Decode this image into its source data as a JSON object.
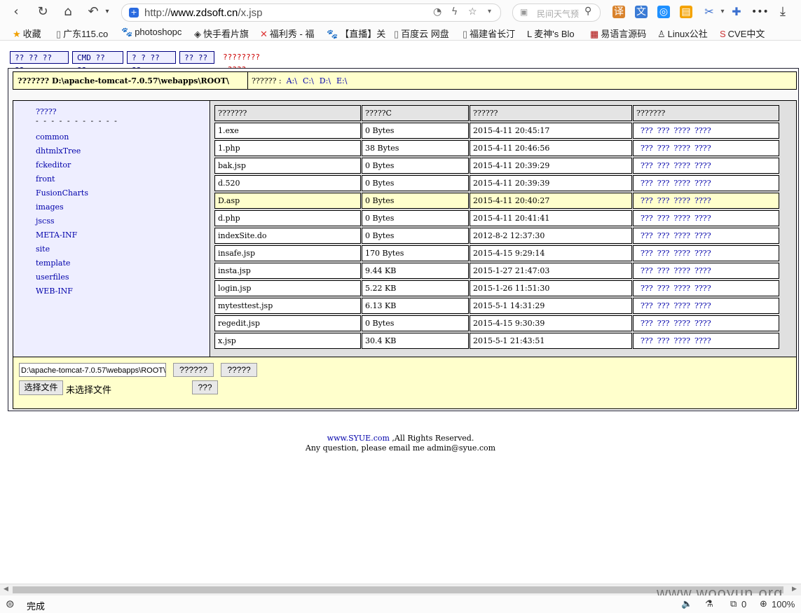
{
  "browser": {
    "url_prefix": "http://",
    "url_host": "www.zdsoft.cn",
    "url_path": "/x.jsp",
    "search_placeholder": "民间天气预",
    "nav": {
      "back": "‹",
      "refresh": "↻",
      "home": "⌂",
      "undo": "↶"
    },
    "menu_icon": "•••",
    "download_icon": "⤓"
  },
  "bookmarks": [
    {
      "label": "收藏",
      "icon": "★"
    },
    {
      "label": "广东115.co",
      "icon": "▯"
    },
    {
      "label": "photoshopc",
      "icon": "🐾"
    },
    {
      "label": "快手看片旗",
      "icon": "◈"
    },
    {
      "label": "福利秀 - 福",
      "icon": "✕"
    },
    {
      "label": "【直播】关",
      "icon": "🐾"
    },
    {
      "label": "百度云 网盘",
      "icon": "▯"
    },
    {
      "label": "福建省长汀",
      "icon": "▯"
    },
    {
      "label": "麦神's Blo",
      "icon": "L"
    },
    {
      "label": "易语言源码",
      "icon": "▦"
    },
    {
      "label": "Linux公社",
      "icon": "♙"
    },
    {
      "label": "CVE中文",
      "icon": "S"
    }
  ],
  "page": {
    "tabs": [
      "?? ?? ?? ??",
      "CMD ?? ??",
      "? ? ?? ??",
      "?? ??"
    ],
    "tab_note": "????????-????",
    "current_path_label": "???????",
    "current_path": "D:\\apache-tomcat-7.0.57\\webapps\\ROOT\\",
    "drives_label": "?????? :",
    "drives": [
      "A:\\",
      "C:\\",
      "D:\\",
      "E:\\"
    ],
    "dir_panel_title": "?????",
    "dir_panel_dash": "- - - - - - - - - - -",
    "directories": [
      "common",
      "dhtmlxTree",
      "fckeditor",
      "front",
      "FusionCharts",
      "images",
      "jscss",
      "META-INF",
      "site",
      "template",
      "userfiles",
      "WEB-INF"
    ],
    "file_headers": [
      "???????",
      "?????C",
      "??????",
      "???????"
    ],
    "files": [
      {
        "name": "1.exe",
        "size": "0 Bytes",
        "date": "2015-4-11 20:45:17"
      },
      {
        "name": "1.php",
        "size": "38 Bytes",
        "date": "2015-4-11 20:46:56"
      },
      {
        "name": "bak.jsp",
        "size": "0 Bytes",
        "date": "2015-4-11 20:39:29"
      },
      {
        "name": "d.520",
        "size": "0 Bytes",
        "date": "2015-4-11 20:39:39"
      },
      {
        "name": "D.asp",
        "size": "0 Bytes",
        "date": "2015-4-11 20:40:27"
      },
      {
        "name": "d.php",
        "size": "0 Bytes",
        "date": "2015-4-11 20:41:41"
      },
      {
        "name": "indexSite.do",
        "size": "0 Bytes",
        "date": "2012-8-2 12:37:30"
      },
      {
        "name": "insafe.jsp",
        "size": "170 Bytes",
        "date": "2015-4-15 9:29:14"
      },
      {
        "name": "insta.jsp",
        "size": "9.44 KB",
        "date": "2015-1-27 21:47:03"
      },
      {
        "name": "login.jsp",
        "size": "5.22 KB",
        "date": "2015-1-26 11:51:30"
      },
      {
        "name": "mytesttest.jsp",
        "size": "6.13 KB",
        "date": "2015-5-1 14:31:29"
      },
      {
        "name": "regedit.jsp",
        "size": "0 Bytes",
        "date": "2015-4-15 9:30:39"
      },
      {
        "name": "x.jsp",
        "size": "30.4 KB",
        "date": "2015-5-1 21:43:51"
      }
    ],
    "highlight_row": 4,
    "actions": [
      "???",
      "???",
      "????",
      "????"
    ],
    "path_input_value": "D:\\apache-tomcat-7.0.57\\webapps\\ROOT\\",
    "btn_create_file": "??????",
    "btn_create_dir": "?????",
    "choose_file": "选择文件",
    "no_file": "未选择文件",
    "btn_upload": "???",
    "footer_link": "www.SYUE.com",
    "footer_line1_rest": " ,All Rights Reserved.",
    "footer_line2": "Any question, please email me admin@syue.com"
  },
  "status": {
    "text": "完成",
    "zoom": "100%",
    "count": "0"
  },
  "watermark": "www.wooyun.org",
  "colors": {
    "link": "#0000aa",
    "panel_yellow": "#ffffcc",
    "panel_blue": "#eeeeff",
    "highlight": "#ffffcc"
  }
}
